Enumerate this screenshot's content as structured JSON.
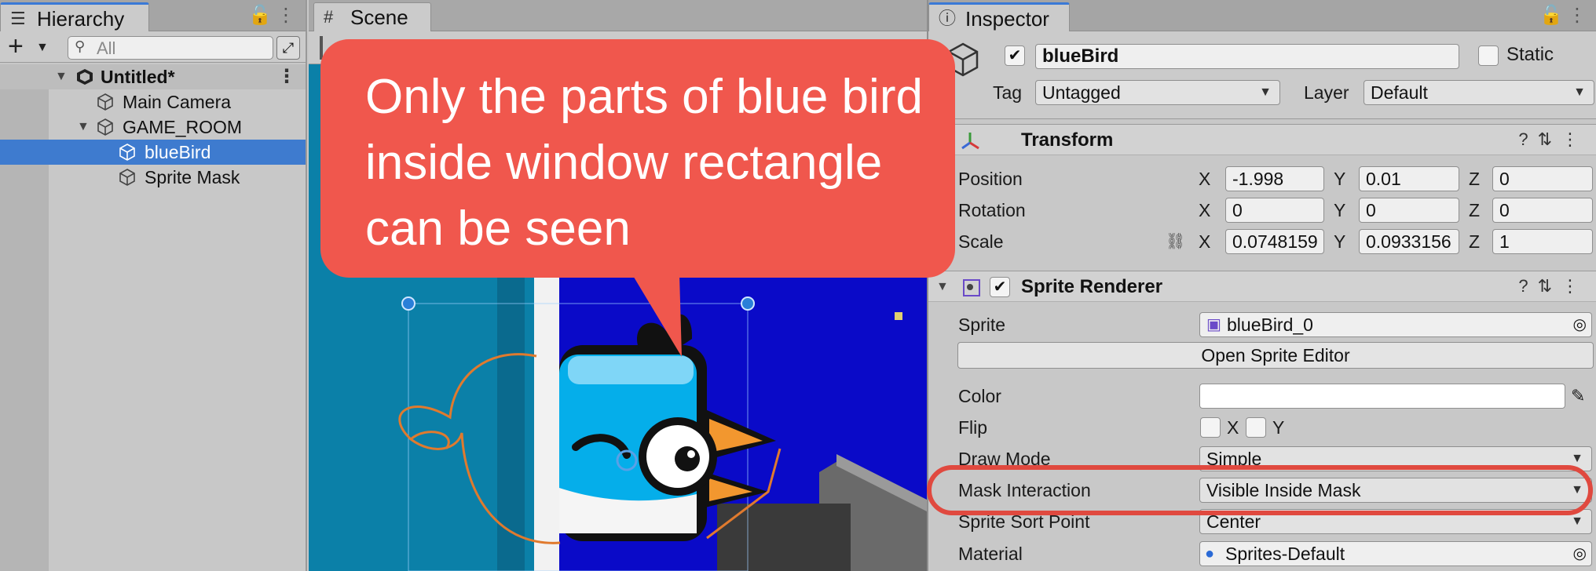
{
  "hierarchy": {
    "tab_label": "Hierarchy",
    "search_placeholder": "All",
    "scene_name": "Untitled*",
    "items": [
      {
        "label": "Main Camera"
      },
      {
        "label": "GAME_ROOM"
      },
      {
        "label": "blueBird"
      },
      {
        "label": "Sprite Mask"
      }
    ]
  },
  "scene": {
    "tab_label": "Scene"
  },
  "inspector": {
    "tab_label": "Inspector",
    "object_name": "blueBird",
    "active": true,
    "static_label": "Static",
    "static": false,
    "tag_label": "Tag",
    "tag_value": "Untagged",
    "layer_label": "Layer",
    "layer_value": "Default",
    "transform": {
      "title": "Transform",
      "position_label": "Position",
      "rotation_label": "Rotation",
      "scale_label": "Scale",
      "x": "X",
      "y": "Y",
      "z": "Z",
      "position": {
        "x": "-1.998",
        "y": "0.01",
        "z": "0"
      },
      "rotation": {
        "x": "0",
        "y": "0",
        "z": "0"
      },
      "scale": {
        "x": "0.0748159",
        "y": "0.0933156",
        "z": "1"
      }
    },
    "sprite_renderer": {
      "title": "Sprite Renderer",
      "enabled": true,
      "sprite_label": "Sprite",
      "sprite_value": "blueBird_0",
      "open_editor_label": "Open Sprite Editor",
      "color_label": "Color",
      "color_value": "#FFFFFF",
      "flip_label": "Flip",
      "flip_x": "X",
      "flip_y": "Y",
      "draw_mode_label": "Draw Mode",
      "draw_mode_value": "Simple",
      "mask_interaction_label": "Mask Interaction",
      "mask_interaction_value": "Visible Inside Mask",
      "sort_point_label": "Sprite Sort Point",
      "sort_point_value": "Center",
      "material_label": "Material",
      "material_value": "Sprites-Default"
    }
  },
  "annotation": {
    "callout_text": "Only the parts of blue bird inside window rectangle can be seen",
    "callout_color": "#F0574D",
    "highlight_color": "#E0493F"
  },
  "colors": {
    "selection": "#3E7BCF",
    "scene_sky": "#0A0AC8",
    "scene_water": "#0B80A8",
    "bird_blue": "#05AEEA",
    "bird_outline": "#E07A2E"
  }
}
